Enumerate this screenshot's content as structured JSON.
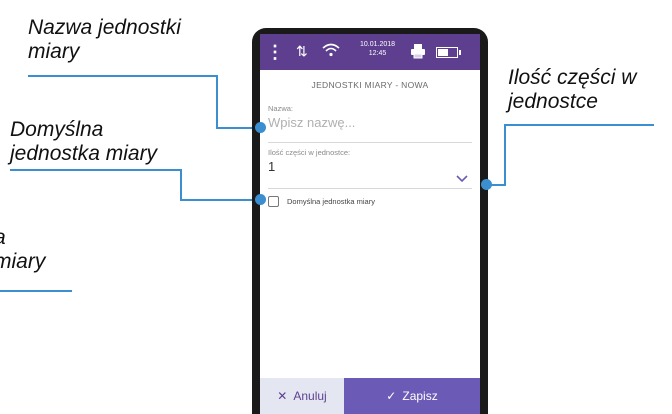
{
  "annotations": {
    "top_left": "Nazwa jednostki\nmiary",
    "left": "Domyślna\njednostka miary",
    "right": "Ilość części w\njednostce",
    "bottom_left": "a\nmiary"
  },
  "statusbar": {
    "date": "10.01.2018",
    "time": "12:45",
    "icons": [
      "menu-dots-icon",
      "transfer-arrows-icon",
      "wifi-icon",
      "printer-icon",
      "battery-icon"
    ]
  },
  "screen": {
    "title": "JEDNOSTKI MIARY - NOWA",
    "name_field": {
      "label": "Nazwa:",
      "placeholder": "Wpisz nazwę..."
    },
    "qty_field": {
      "label": "Ilość części w jednostce:",
      "value": "1"
    },
    "default_checkbox": {
      "label": "Domyślna jednostka miary",
      "checked": false
    }
  },
  "buttons": {
    "cancel_label": "Anuluj",
    "save_label": "Zapisz"
  },
  "colors": {
    "statusbar": "#5e3f8f",
    "save_button": "#6c5bb6",
    "cancel_button": "#e4e7f2",
    "annotation_line": "#3b8fd0"
  }
}
